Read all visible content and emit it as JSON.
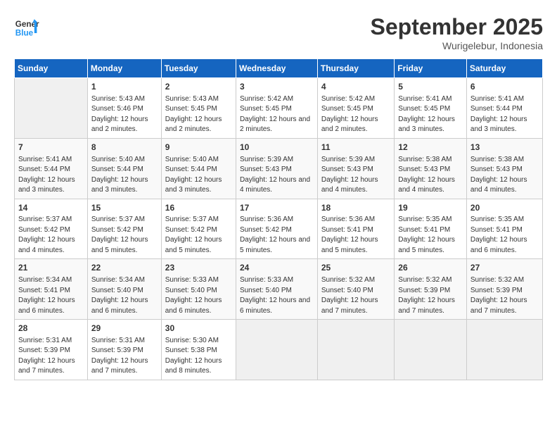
{
  "header": {
    "logo_line1": "General",
    "logo_line2": "Blue",
    "month": "September 2025",
    "location": "Wurigelebur, Indonesia"
  },
  "days_of_week": [
    "Sunday",
    "Monday",
    "Tuesday",
    "Wednesday",
    "Thursday",
    "Friday",
    "Saturday"
  ],
  "weeks": [
    [
      {
        "day": "",
        "empty": true
      },
      {
        "day": "1",
        "sunrise": "5:43 AM",
        "sunset": "5:46 PM",
        "daylight": "12 hours and 2 minutes."
      },
      {
        "day": "2",
        "sunrise": "5:43 AM",
        "sunset": "5:45 PM",
        "daylight": "12 hours and 2 minutes."
      },
      {
        "day": "3",
        "sunrise": "5:42 AM",
        "sunset": "5:45 PM",
        "daylight": "12 hours and 2 minutes."
      },
      {
        "day": "4",
        "sunrise": "5:42 AM",
        "sunset": "5:45 PM",
        "daylight": "12 hours and 2 minutes."
      },
      {
        "day": "5",
        "sunrise": "5:41 AM",
        "sunset": "5:45 PM",
        "daylight": "12 hours and 3 minutes."
      },
      {
        "day": "6",
        "sunrise": "5:41 AM",
        "sunset": "5:44 PM",
        "daylight": "12 hours and 3 minutes."
      }
    ],
    [
      {
        "day": "7",
        "sunrise": "5:41 AM",
        "sunset": "5:44 PM",
        "daylight": "12 hours and 3 minutes."
      },
      {
        "day": "8",
        "sunrise": "5:40 AM",
        "sunset": "5:44 PM",
        "daylight": "12 hours and 3 minutes."
      },
      {
        "day": "9",
        "sunrise": "5:40 AM",
        "sunset": "5:44 PM",
        "daylight": "12 hours and 3 minutes."
      },
      {
        "day": "10",
        "sunrise": "5:39 AM",
        "sunset": "5:43 PM",
        "daylight": "12 hours and 4 minutes."
      },
      {
        "day": "11",
        "sunrise": "5:39 AM",
        "sunset": "5:43 PM",
        "daylight": "12 hours and 4 minutes."
      },
      {
        "day": "12",
        "sunrise": "5:38 AM",
        "sunset": "5:43 PM",
        "daylight": "12 hours and 4 minutes."
      },
      {
        "day": "13",
        "sunrise": "5:38 AM",
        "sunset": "5:43 PM",
        "daylight": "12 hours and 4 minutes."
      }
    ],
    [
      {
        "day": "14",
        "sunrise": "5:37 AM",
        "sunset": "5:42 PM",
        "daylight": "12 hours and 4 minutes."
      },
      {
        "day": "15",
        "sunrise": "5:37 AM",
        "sunset": "5:42 PM",
        "daylight": "12 hours and 5 minutes."
      },
      {
        "day": "16",
        "sunrise": "5:37 AM",
        "sunset": "5:42 PM",
        "daylight": "12 hours and 5 minutes."
      },
      {
        "day": "17",
        "sunrise": "5:36 AM",
        "sunset": "5:42 PM",
        "daylight": "12 hours and 5 minutes."
      },
      {
        "day": "18",
        "sunrise": "5:36 AM",
        "sunset": "5:41 PM",
        "daylight": "12 hours and 5 minutes."
      },
      {
        "day": "19",
        "sunrise": "5:35 AM",
        "sunset": "5:41 PM",
        "daylight": "12 hours and 5 minutes."
      },
      {
        "day": "20",
        "sunrise": "5:35 AM",
        "sunset": "5:41 PM",
        "daylight": "12 hours and 6 minutes."
      }
    ],
    [
      {
        "day": "21",
        "sunrise": "5:34 AM",
        "sunset": "5:41 PM",
        "daylight": "12 hours and 6 minutes."
      },
      {
        "day": "22",
        "sunrise": "5:34 AM",
        "sunset": "5:40 PM",
        "daylight": "12 hours and 6 minutes."
      },
      {
        "day": "23",
        "sunrise": "5:33 AM",
        "sunset": "5:40 PM",
        "daylight": "12 hours and 6 minutes."
      },
      {
        "day": "24",
        "sunrise": "5:33 AM",
        "sunset": "5:40 PM",
        "daylight": "12 hours and 6 minutes."
      },
      {
        "day": "25",
        "sunrise": "5:32 AM",
        "sunset": "5:40 PM",
        "daylight": "12 hours and 7 minutes."
      },
      {
        "day": "26",
        "sunrise": "5:32 AM",
        "sunset": "5:39 PM",
        "daylight": "12 hours and 7 minutes."
      },
      {
        "day": "27",
        "sunrise": "5:32 AM",
        "sunset": "5:39 PM",
        "daylight": "12 hours and 7 minutes."
      }
    ],
    [
      {
        "day": "28",
        "sunrise": "5:31 AM",
        "sunset": "5:39 PM",
        "daylight": "12 hours and 7 minutes."
      },
      {
        "day": "29",
        "sunrise": "5:31 AM",
        "sunset": "5:39 PM",
        "daylight": "12 hours and 7 minutes."
      },
      {
        "day": "30",
        "sunrise": "5:30 AM",
        "sunset": "5:38 PM",
        "daylight": "12 hours and 8 minutes."
      },
      {
        "day": "",
        "empty": true
      },
      {
        "day": "",
        "empty": true
      },
      {
        "day": "",
        "empty": true
      },
      {
        "day": "",
        "empty": true
      }
    ]
  ]
}
